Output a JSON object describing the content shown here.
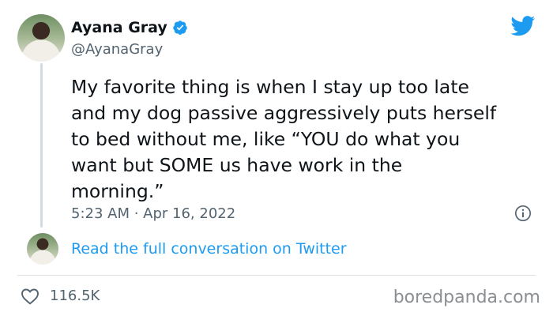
{
  "author": {
    "name": "Ayana Gray",
    "handle": "@AyanaGray"
  },
  "tweet": {
    "lines": [
      "My favorite thing is when I stay up too late",
      "and my dog passive aggressively puts herself",
      "to bed without me, like “YOU do what you",
      "want but SOME us have work in the",
      "morning.”"
    ],
    "timestamp": "5:23 AM · Apr 16, 2022"
  },
  "conversation": {
    "link_label": "Read the full conversation on Twitter"
  },
  "engagement": {
    "likes": "116.5K"
  },
  "watermark": "boredpanda.com",
  "colors": {
    "accent": "#1d9bf0",
    "secondary_text": "#536471",
    "primary_text": "#0f1419"
  },
  "icons": [
    "verified-badge-icon",
    "twitter-bird-icon",
    "info-icon",
    "heart-icon"
  ]
}
